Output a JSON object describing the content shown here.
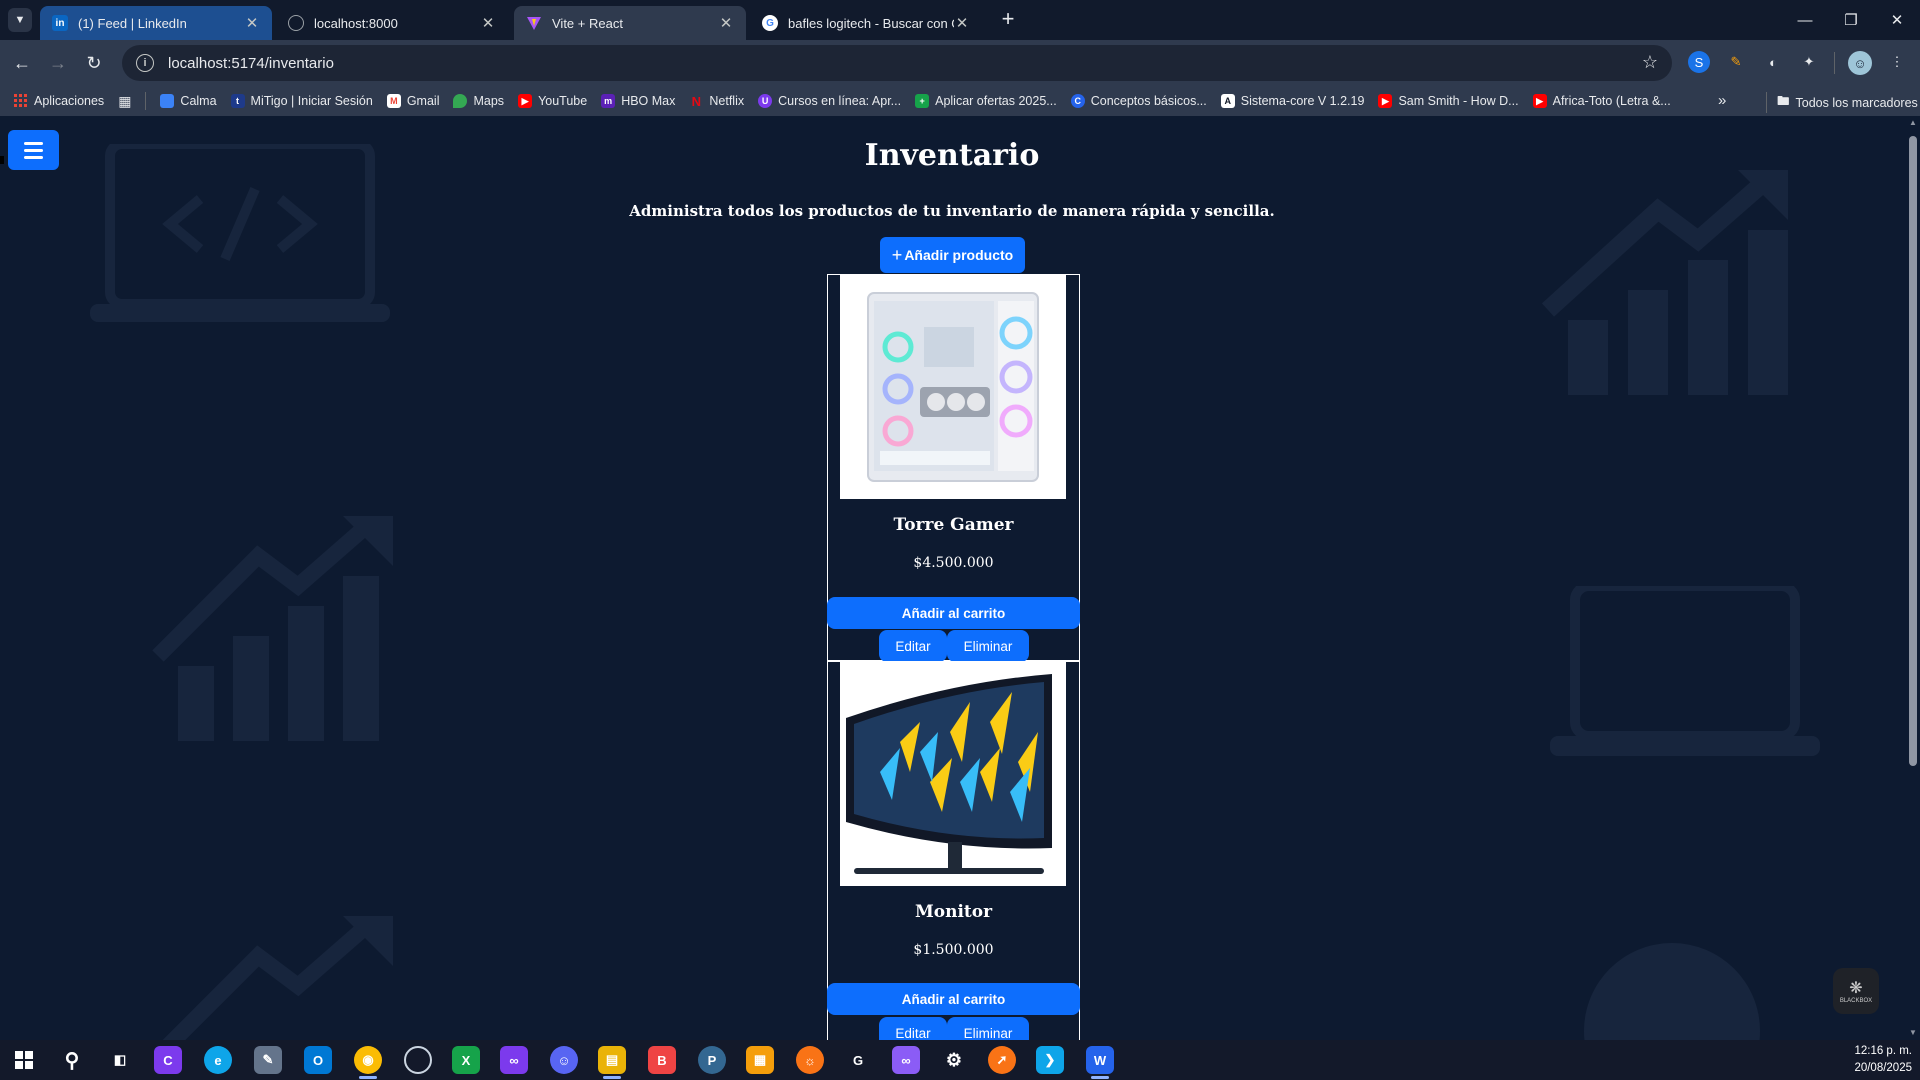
{
  "browser": {
    "tabs": [
      {
        "title": "(1) Feed | LinkedIn",
        "icon": "linkedin-icon",
        "color": "#0a66c2"
      },
      {
        "title": "localhost:8000",
        "icon": "globe-icon",
        "color": "#9aa0a6"
      },
      {
        "title": "Vite + React",
        "icon": "vite-icon",
        "color": "#a855f7"
      },
      {
        "title": "bafles logitech - Buscar con Go",
        "icon": "google-icon",
        "color": "#4285f4"
      }
    ],
    "url": "localhost:5174/inventario",
    "bookmarks": [
      {
        "label": "Aplicaciones",
        "icon": "apps-grid-icon",
        "color": "#ea4335"
      },
      {
        "label": "Calma",
        "icon": "calma-icon",
        "color": "#3b82f6"
      },
      {
        "label": "MiTigo | Iniciar Sesión",
        "icon": "tigo-icon",
        "color": "#1e3a8a"
      },
      {
        "label": "Gmail",
        "icon": "gmail-icon",
        "color": "#ea4335"
      },
      {
        "label": "Maps",
        "icon": "maps-icon",
        "color": "#34a853"
      },
      {
        "label": "YouTube",
        "icon": "youtube-icon",
        "color": "#ff0000"
      },
      {
        "label": "HBO Max",
        "icon": "hbomax-icon",
        "color": "#5b21b6"
      },
      {
        "label": "Netflix",
        "icon": "netflix-icon",
        "color": "#e50914"
      },
      {
        "label": "Cursos en línea: Apr...",
        "icon": "cursos-icon",
        "color": "#7c3aed"
      },
      {
        "label": "Aplicar ofertas 2025...",
        "icon": "sheets-icon",
        "color": "#16a34a"
      },
      {
        "label": "Conceptos básicos...",
        "icon": "conceptos-icon",
        "color": "#2563eb"
      },
      {
        "label": "Sistema-core V 1.2.19",
        "icon": "sistema-icon",
        "color": "#111827"
      },
      {
        "label": "Sam Smith - How D...",
        "icon": "youtube-icon",
        "color": "#ff0000"
      },
      {
        "label": "Africa-Toto (Letra &...",
        "icon": "youtube-icon",
        "color": "#ff0000"
      }
    ],
    "all_bookmarks": "Todos los marcadores"
  },
  "page": {
    "title": "Inventario",
    "subtitle": "Administra todos los productos de tu inventario de manera rápida y sencilla.",
    "add_button": "Añadir producto",
    "products": [
      {
        "name": "Torre Gamer",
        "price": "$4.500.000",
        "cart": "Añadir al carrito",
        "edit": "Editar",
        "delete": "Eliminar"
      },
      {
        "name": "Monitor",
        "price": "$1.500.000",
        "cart": "Añadir al carrito",
        "edit": "Editar",
        "delete": "Eliminar"
      }
    ],
    "blackbox": "BLACKBOX"
  },
  "taskbar": {
    "time": "12:16 p. m.",
    "date": "20/08/2025"
  },
  "colors": {
    "accent": "#0d6efd",
    "page_bg": "#0d1a30",
    "chrome": "#2f3a4e"
  }
}
